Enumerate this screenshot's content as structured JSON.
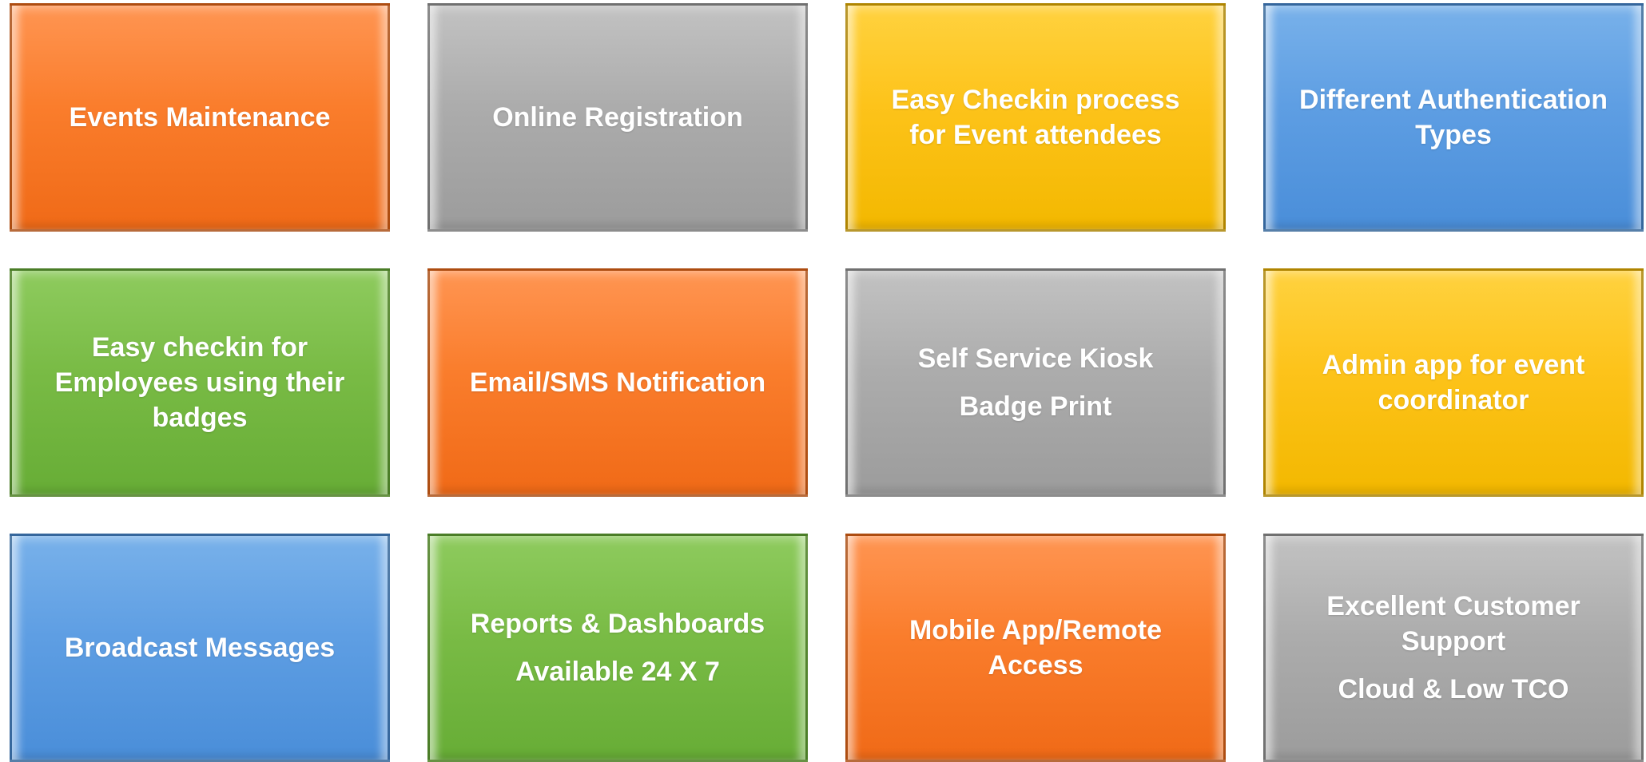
{
  "tiles": [
    {
      "id": "events-maintenance",
      "lines": [
        "Events Maintenance"
      ],
      "color": "#fa7d2c"
    },
    {
      "id": "online-registration",
      "lines": [
        "Online Registration"
      ],
      "color": "#acacac"
    },
    {
      "id": "easy-checkin-process",
      "lines": [
        "Easy Checkin process for Event attendees"
      ],
      "color": "#fdc31a"
    },
    {
      "id": "authentication-types",
      "lines": [
        "Different Authentication Types"
      ],
      "color": "#5e9ee3"
    },
    {
      "id": "employee-checkin",
      "lines": [
        "Easy checkin for Employees using their badges"
      ],
      "color": "#79bb45"
    },
    {
      "id": "email-sms",
      "lines": [
        "Email/SMS Notification"
      ],
      "color": "#fa7d2c"
    },
    {
      "id": "kiosk",
      "lines": [
        "Self Service Kiosk",
        "Badge Print"
      ],
      "color": "#acacac"
    },
    {
      "id": "admin-app",
      "lines": [
        "Admin app for event coordinator"
      ],
      "color": "#fdc31a"
    },
    {
      "id": "broadcast",
      "lines": [
        "Broadcast Messages"
      ],
      "color": "#5e9ee3"
    },
    {
      "id": "reports",
      "lines": [
        "Reports & Dashboards",
        "Available 24 X 7"
      ],
      "color": "#79bb45"
    },
    {
      "id": "mobile-app",
      "lines": [
        "Mobile App/Remote Access"
      ],
      "color": "#fa7d2c"
    },
    {
      "id": "support",
      "lines": [
        "Excellent Customer Support",
        "Cloud & Low TCO"
      ],
      "color": "#acacac"
    }
  ]
}
